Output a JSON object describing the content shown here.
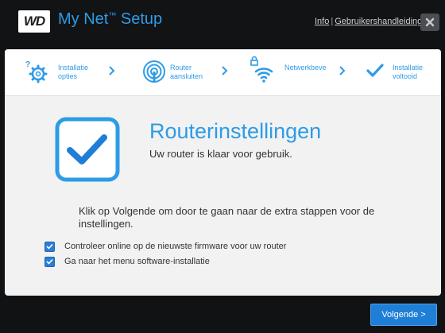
{
  "header": {
    "logo_text": "WD",
    "app_name": "My Net",
    "trademark": "™",
    "app_suffix": " Setup",
    "info_link": "Info",
    "separator": "|",
    "manual_link": "Gebruikershandleiding",
    "close_icon": "close-icon"
  },
  "steps": [
    {
      "icon": "gear-question-icon",
      "label_line1": "Installatie",
      "label_line2": "opties"
    },
    {
      "icon": "router-icon",
      "label_line1": "Router",
      "label_line2": "aansluiten"
    },
    {
      "icon": "wifi-lock-icon",
      "label_line1": "Netwerkbeve",
      "label_line2": ""
    },
    {
      "icon": "checkmark-icon",
      "label_line1": "Installatie",
      "label_line2": "voltooid"
    }
  ],
  "main": {
    "heading": "Routerinstellingen",
    "subheading": "Uw router is klaar voor gebruik.",
    "instruction": "Klik op Volgende om door te gaan naar de extra stappen voor de instellingen.",
    "options": [
      {
        "label": "Controleer online op de nieuwste firmware voor uw router",
        "checked": true
      },
      {
        "label": "Ga naar het menu software-installatie",
        "checked": true
      }
    ]
  },
  "footer": {
    "next_label": "Volgende >"
  },
  "colors": {
    "accent": "#2e9be6",
    "button": "#1f7fd6",
    "background": "#111214"
  }
}
